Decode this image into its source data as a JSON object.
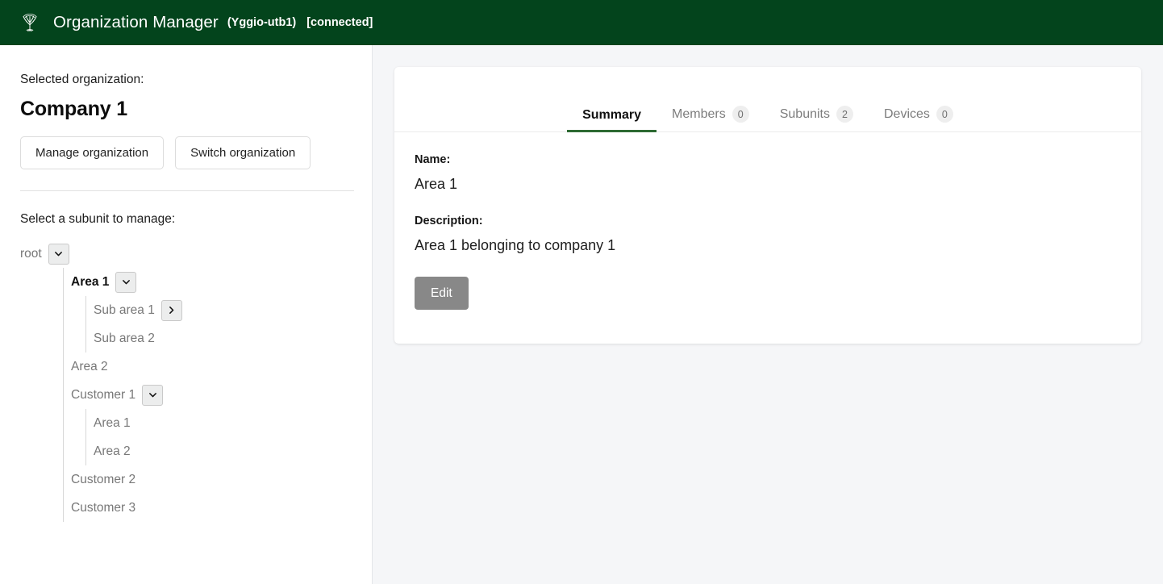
{
  "header": {
    "logo_icon": "tree-icon",
    "title": "Organization Manager",
    "instance": "(Yggio-utb1)",
    "connection_status": "[connected]",
    "background_color": "#03441c",
    "text_color": "#ffffff"
  },
  "sidebar": {
    "selected_org_label": "Selected organization:",
    "organization_name": "Company 1",
    "manage_button": "Manage organization",
    "switch_button": "Switch organization",
    "subunit_prompt": "Select a subunit to manage:",
    "tree": {
      "root": {
        "label": "root",
        "toggle_icon": "chevron-down-icon",
        "expanded": true,
        "selected": false
      },
      "children": [
        {
          "label": "Area 1",
          "toggle_icon": "chevron-down-icon",
          "expanded": true,
          "selected": true,
          "children": [
            {
              "label": "Sub area 1",
              "toggle_icon": "chevron-right-icon",
              "expanded": false,
              "selected": false
            },
            {
              "label": "Sub area 2",
              "toggle_icon": null,
              "expanded": false,
              "selected": false
            }
          ]
        },
        {
          "label": "Area 2",
          "toggle_icon": null,
          "expanded": false,
          "selected": false
        },
        {
          "label": "Customer 1",
          "toggle_icon": "chevron-down-icon",
          "expanded": true,
          "selected": false,
          "children": [
            {
              "label": "Area 1",
              "toggle_icon": null,
              "expanded": false,
              "selected": false
            },
            {
              "label": "Area 2",
              "toggle_icon": null,
              "expanded": false,
              "selected": false
            }
          ]
        },
        {
          "label": "Customer 2",
          "toggle_icon": null,
          "expanded": false,
          "selected": false
        },
        {
          "label": "Customer 3",
          "toggle_icon": null,
          "expanded": false,
          "selected": false
        }
      ]
    }
  },
  "main": {
    "tabs": [
      {
        "label": "Summary",
        "badge": null,
        "active": true
      },
      {
        "label": "Members",
        "badge": "0",
        "active": false
      },
      {
        "label": "Subunits",
        "badge": "2",
        "active": false
      },
      {
        "label": "Devices",
        "badge": "0",
        "active": false
      }
    ],
    "active_tab_accent": "#2d6a32",
    "summary": {
      "name_label": "Name:",
      "name_value": "Area 1",
      "description_label": "Description:",
      "description_value": "Area 1 belonging to company 1",
      "edit_button": "Edit",
      "edit_button_color": "#888888"
    }
  }
}
